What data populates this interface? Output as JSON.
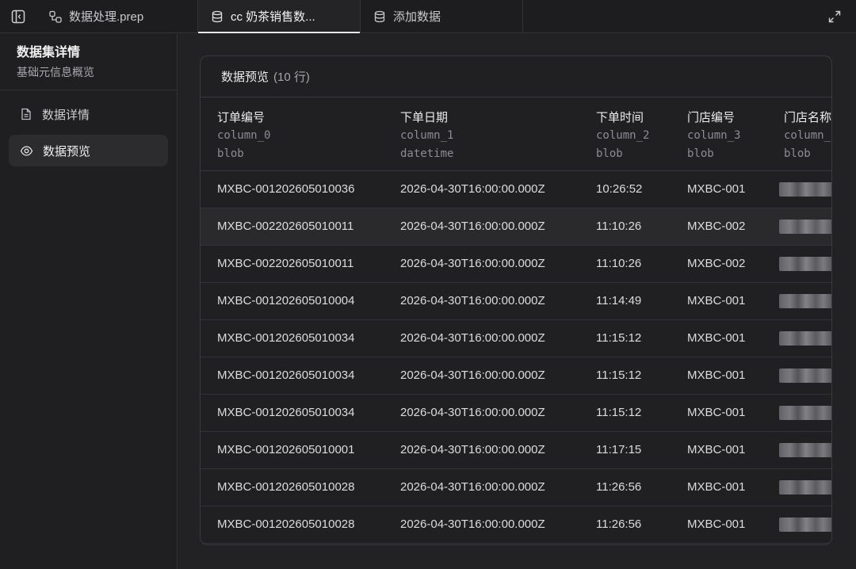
{
  "tabs": [
    {
      "label": "数据处理.prep",
      "icon": "flow-icon",
      "active": false
    },
    {
      "label": "cc 奶茶销售数...",
      "icon": "database-icon",
      "active": true
    },
    {
      "label": "添加数据",
      "icon": "database-icon",
      "active": false
    }
  ],
  "sidebar": {
    "title": "数据集详情",
    "subtitle": "基础元信息概览",
    "items": [
      {
        "label": "数据详情",
        "icon": "document-icon",
        "active": false
      },
      {
        "label": "数据预览",
        "icon": "eye-icon",
        "active": true
      }
    ]
  },
  "preview": {
    "title": "数据预览",
    "count": "(10 行)",
    "columns": [
      {
        "name": "订单编号",
        "id": "column_0",
        "type": "blob"
      },
      {
        "name": "下单日期",
        "id": "column_1",
        "type": "datetime"
      },
      {
        "name": "下单时间",
        "id": "column_2",
        "type": "blob"
      },
      {
        "name": "门店编号",
        "id": "column_3",
        "type": "blob"
      },
      {
        "name": "门店名称",
        "id": "column_",
        "type": "blob"
      }
    ],
    "rows": [
      [
        "MXBC-001202605010036",
        "2026-04-30T16:00:00.000Z",
        "10:26:52",
        "MXBC-001",
        ""
      ],
      [
        "MXBC-002202605010011",
        "2026-04-30T16:00:00.000Z",
        "11:10:26",
        "MXBC-002",
        ""
      ],
      [
        "MXBC-002202605010011",
        "2026-04-30T16:00:00.000Z",
        "11:10:26",
        "MXBC-002",
        ""
      ],
      [
        "MXBC-001202605010004",
        "2026-04-30T16:00:00.000Z",
        "11:14:49",
        "MXBC-001",
        ""
      ],
      [
        "MXBC-001202605010034",
        "2026-04-30T16:00:00.000Z",
        "11:15:12",
        "MXBC-001",
        ""
      ],
      [
        "MXBC-001202605010034",
        "2026-04-30T16:00:00.000Z",
        "11:15:12",
        "MXBC-001",
        ""
      ],
      [
        "MXBC-001202605010034",
        "2026-04-30T16:00:00.000Z",
        "11:15:12",
        "MXBC-001",
        ""
      ],
      [
        "MXBC-001202605010001",
        "2026-04-30T16:00:00.000Z",
        "11:17:15",
        "MXBC-001",
        ""
      ],
      [
        "MXBC-001202605010028",
        "2026-04-30T16:00:00.000Z",
        "11:26:56",
        "MXBC-001",
        ""
      ],
      [
        "MXBC-001202605010028",
        "2026-04-30T16:00:00.000Z",
        "11:26:56",
        "MXBC-001",
        ""
      ]
    ]
  }
}
